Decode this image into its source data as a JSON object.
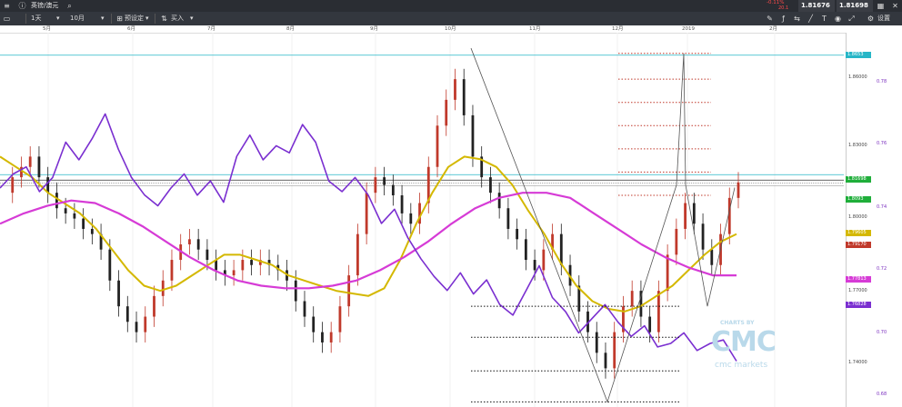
{
  "header": {
    "instrument": "英镑/澳元",
    "change": "-0.11%",
    "change_sub": "20.1",
    "sell_price": "1.81676",
    "buy_price": "1.81698",
    "settings_label": "设置"
  },
  "toolbar": {
    "interval": "1天",
    "range": "10月",
    "preset_label": "预设定",
    "buy_label": "买入"
  },
  "colors": {
    "candle_up": "#c0392b",
    "candle_down": "#222222",
    "sma_short": "#d4b800",
    "sma_long": "#d63bd6",
    "indicator": "#7a2fd0",
    "hline_cyan": "#26b6c7",
    "level_red": "#c0392b",
    "level_green": "#2ea84a",
    "level_black": "#111111",
    "price_tag": "#1fae3a"
  },
  "chart_data": {
    "type": "line",
    "x": [
      "5月",
      "6月",
      "7月",
      "8月",
      "9月",
      "10月",
      "11月",
      "12月",
      "2019",
      "2月"
    ],
    "y_axis_left": {
      "ticks": [
        "1.86000",
        "1.83000",
        "1.80000",
        "1.77000",
        "1.74000"
      ],
      "ylim": [
        1.729,
        1.874
      ]
    },
    "y_axis_right": {
      "ticks": [
        "0.78",
        "0.76",
        "0.74",
        "0.72",
        "0.70",
        "0.68"
      ],
      "ylim": [
        0.676,
        0.782
      ]
    },
    "price_tags": [
      {
        "label": "1.8653",
        "value": 1.8653,
        "color": "#26b6c7"
      },
      {
        "label": "1.8169",
        "value": 1.8169,
        "color": "#26b6c7"
      },
      {
        "label": "1.81698",
        "value": 1.81698,
        "color": "#1fae3a"
      },
      {
        "label": "1.8093",
        "value": 1.8093,
        "color": "#1fae3a"
      },
      {
        "label": "1.79605",
        "value": 1.79605,
        "color": "#d4b800"
      },
      {
        "label": "1.79170",
        "value": 1.7917,
        "color": "#c0392b"
      },
      {
        "label": "1.77813",
        "value": 1.77813,
        "color": "#d63bd6"
      },
      {
        "label": "1.76828",
        "value": 1.76828,
        "color": "#7a2fd0"
      }
    ],
    "series": [
      {
        "name": "",
        "values": [
          1.812,
          1.818,
          1.822,
          1.826,
          1.818,
          1.812,
          1.806,
          1.804,
          1.802,
          1.798,
          1.796,
          1.79,
          1.778,
          1.768,
          1.762,
          1.758,
          1.764,
          1.772,
          1.778,
          1.786,
          1.792,
          1.794,
          1.79,
          1.786,
          1.782,
          1.78,
          1.782,
          1.786,
          1.784,
          1.786,
          1.784,
          1.782,
          1.778,
          1.77,
          1.764,
          1.758,
          1.754,
          1.758,
          1.768,
          1.78,
          1.796,
          1.812,
          1.818,
          1.815,
          1.811,
          1.804,
          1.8,
          1.808,
          1.822,
          1.838,
          1.848,
          1.856,
          1.842,
          1.826,
          1.818,
          1.812,
          1.806,
          1.798,
          1.794,
          1.786,
          1.782,
          1.79,
          1.796,
          1.784,
          1.776,
          1.766,
          1.758,
          1.75,
          1.744,
          1.758,
          1.768,
          1.774,
          1.764,
          1.758,
          1.774,
          1.788,
          1.798,
          1.808,
          1.8,
          1.79,
          1.784,
          1.796,
          1.81,
          1.816
        ]
      },
      {
        "name": "",
        "values": [
          1.826,
          1.822,
          1.818,
          1.812,
          1.808,
          1.804,
          1.798,
          1.79,
          1.782,
          1.776,
          1.774,
          1.776,
          1.78,
          1.784,
          1.788,
          1.788,
          1.786,
          1.784,
          1.78,
          1.778,
          1.776,
          1.774,
          1.773,
          1.772,
          1.775,
          1.786,
          1.8,
          1.812,
          1.822,
          1.826,
          1.825,
          1.822,
          1.815,
          1.805,
          1.796,
          1.785,
          1.776,
          1.77,
          1.767,
          1.766,
          1.768,
          1.772,
          1.776,
          1.782,
          1.788,
          1.793,
          1.796
        ]
      },
      {
        "name": "",
        "values": [
          1.8,
          1.804,
          1.807,
          1.809,
          1.808,
          1.804,
          1.799,
          1.793,
          1.787,
          1.782,
          1.778,
          1.776,
          1.775,
          1.775,
          1.776,
          1.778,
          1.782,
          1.787,
          1.793,
          1.8,
          1.806,
          1.81,
          1.812,
          1.812,
          1.81,
          1.804,
          1.798,
          1.792,
          1.787,
          1.783,
          1.78,
          1.78
        ]
      },
      {
        "name": "",
        "values": [
          0.738,
          0.742,
          0.744,
          0.737,
          0.741,
          0.751,
          0.746,
          0.752,
          0.759,
          0.749,
          0.741,
          0.736,
          0.733,
          0.738,
          0.742,
          0.736,
          0.74,
          0.734,
          0.747,
          0.753,
          0.746,
          0.75,
          0.748,
          0.756,
          0.751,
          0.74,
          0.737,
          0.741,
          0.736,
          0.728,
          0.732,
          0.724,
          0.718,
          0.713,
          0.709,
          0.714,
          0.708,
          0.712,
          0.705,
          0.702,
          0.709,
          0.716,
          0.707,
          0.703,
          0.697,
          0.701,
          0.705,
          0.7,
          0.696,
          0.699,
          0.693,
          0.694,
          0.697,
          0.692,
          0.694,
          0.695,
          0.689
        ]
      }
    ],
    "level_lines": [
      {
        "color": "red",
        "values": [
          1.866,
          1.856,
          1.847,
          1.838,
          1.829,
          1.82,
          1.811
        ]
      },
      {
        "color": "black",
        "values": [
          1.768,
          1.756,
          1.743,
          1.731
        ]
      }
    ]
  },
  "branding": {
    "charts_by": "CHARTS BY",
    "logo": "CMC",
    "company": "cmc markets"
  }
}
